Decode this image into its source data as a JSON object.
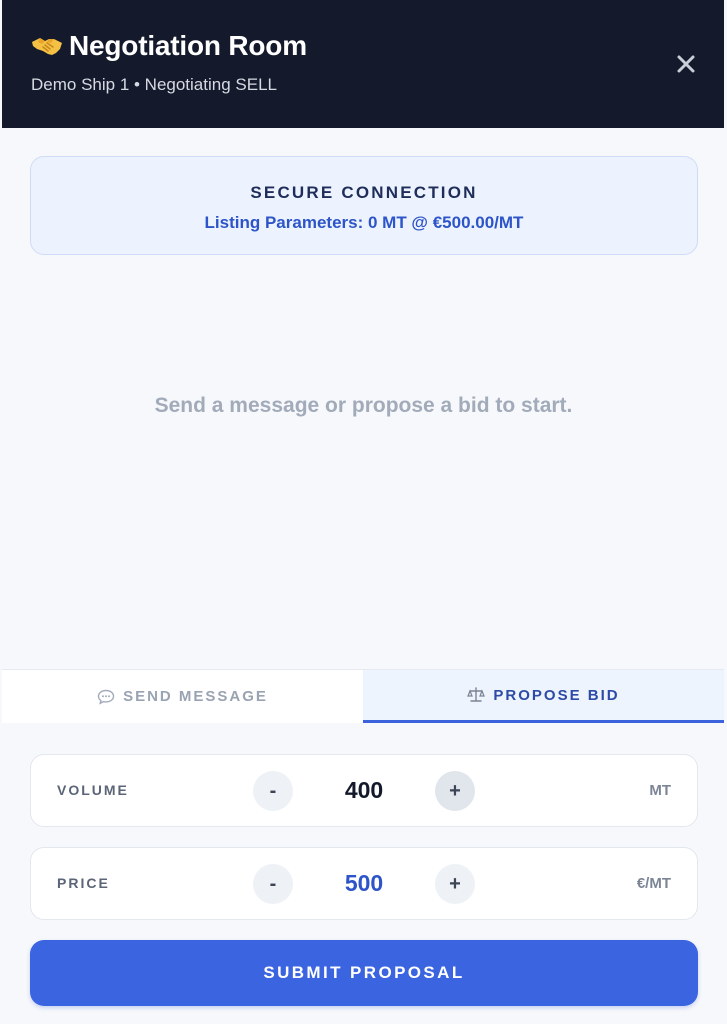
{
  "header": {
    "title": "Negotiation Room",
    "subtitle": "Demo Ship 1 • Negotiating SELL",
    "icon": "handshake-icon",
    "close_icon": "close-icon"
  },
  "connection": {
    "title": "SECURE CONNECTION",
    "params": "Listing Parameters: 0 MT @ €500.00/MT"
  },
  "chat": {
    "empty_text": "Send a message or propose a bid to start."
  },
  "tabs": [
    {
      "label": "SEND MESSAGE",
      "icon": "speech-bubble-icon",
      "active": false
    },
    {
      "label": "PROPOSE BID",
      "icon": "scale-icon",
      "active": true
    }
  ],
  "bid": {
    "volume": {
      "label": "VOLUME",
      "minus": "-",
      "value": "400",
      "plus": "+",
      "unit": "MT"
    },
    "price": {
      "label": "PRICE",
      "minus": "-",
      "value": "500",
      "plus": "+",
      "unit": "€/MT"
    },
    "submit_label": "SUBMIT PROPOSAL"
  },
  "colors": {
    "header_bg": "#141a2b",
    "accent": "#3a64e0",
    "accent_text": "#2d54c8"
  }
}
